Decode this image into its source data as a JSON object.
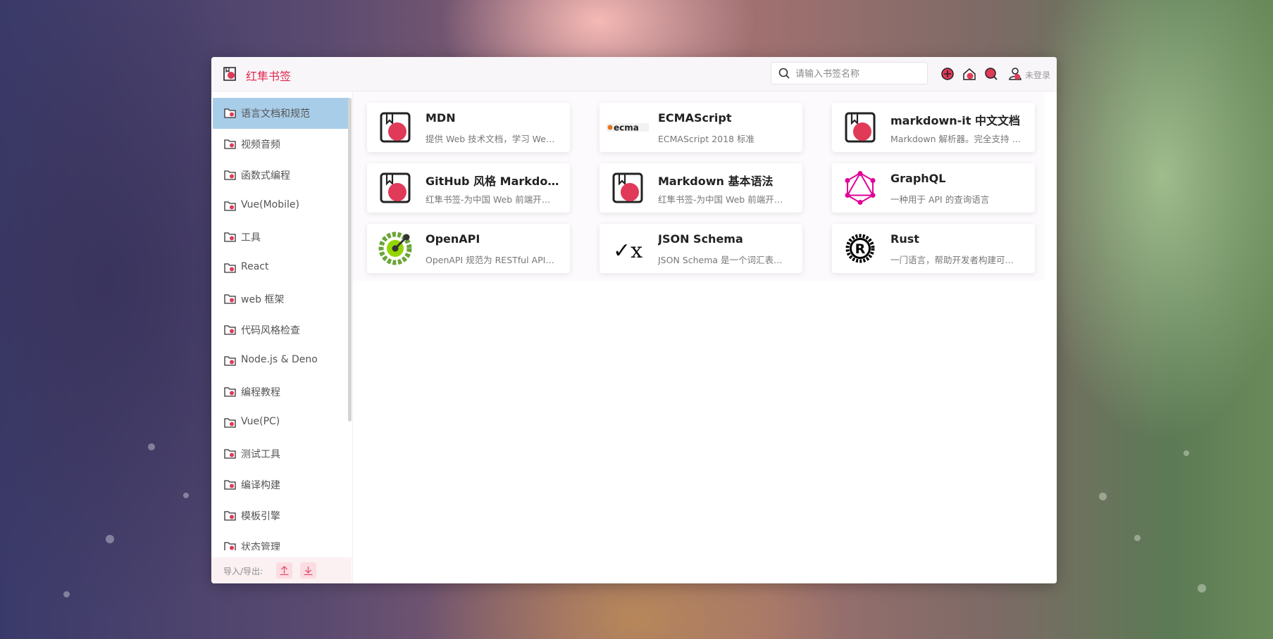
{
  "app": {
    "title": "红隼书签"
  },
  "search": {
    "placeholder": "请输入书签名称"
  },
  "header": {
    "login_label": "未登录"
  },
  "sidebar": {
    "items": [
      {
        "label": "语言文档和规范",
        "active": true
      },
      {
        "label": "视频音频"
      },
      {
        "label": "函数式编程"
      },
      {
        "label": "Vue(Mobile)"
      },
      {
        "label": "工具"
      },
      {
        "label": "React"
      },
      {
        "label": "web 框架"
      },
      {
        "label": "代码风格检查"
      },
      {
        "label": "Node.js & Deno"
      },
      {
        "label": "编程教程"
      },
      {
        "label": "Vue(PC)"
      },
      {
        "label": "测试工具"
      },
      {
        "label": "编译构建"
      },
      {
        "label": "模板引擎"
      },
      {
        "label": "状态管理"
      }
    ],
    "io_label": "导入/导出:"
  },
  "bookmarks": [
    {
      "title": "MDN",
      "desc": "提供 Web 技术文档，学习 Web 开发的最佳实践",
      "icon": "bookmark-logo-icon"
    },
    {
      "title": "ECMAScript",
      "desc": "ECMAScript 2018 标准",
      "icon": "ecma-logo-icon",
      "icon_text": "ecma"
    },
    {
      "title": "markdown-it 中文文档",
      "desc": "Markdown 解析器。完全支持 CommonMark 规范",
      "icon": "bookmark-logo-icon"
    },
    {
      "title": "GitHub 风格 Markdown 规范",
      "desc": "红隼书签-为中国 Web 前端开发人员提供优质书签",
      "icon": "bookmark-logo-icon"
    },
    {
      "title": "Markdown 基本语法",
      "desc": "红隼书签-为中国 Web 前端开发人员提供优质书签",
      "icon": "bookmark-logo-icon"
    },
    {
      "title": "GraphQL",
      "desc": "一种用于 API 的查询语言",
      "icon": "graphql-logo-icon"
    },
    {
      "title": "OpenAPI",
      "desc": "OpenAPI 规范为 RESTful API 定义了一个标准接口",
      "icon": "openapi-logo-icon"
    },
    {
      "title": "JSON Schema",
      "desc": "JSON Schema 是一个词汇表，可用于注释和验证 JSON 文档",
      "icon": "json-schema-logo-icon",
      "icon_text": "{✓x}"
    },
    {
      "title": "Rust",
      "desc": "一门语言，帮助开发者构建可靠且高效的软件",
      "icon": "rust-logo-icon",
      "icon_text": "R"
    }
  ],
  "colors": {
    "brand": "#e0294f",
    "active_bg": "#a8cde8"
  }
}
